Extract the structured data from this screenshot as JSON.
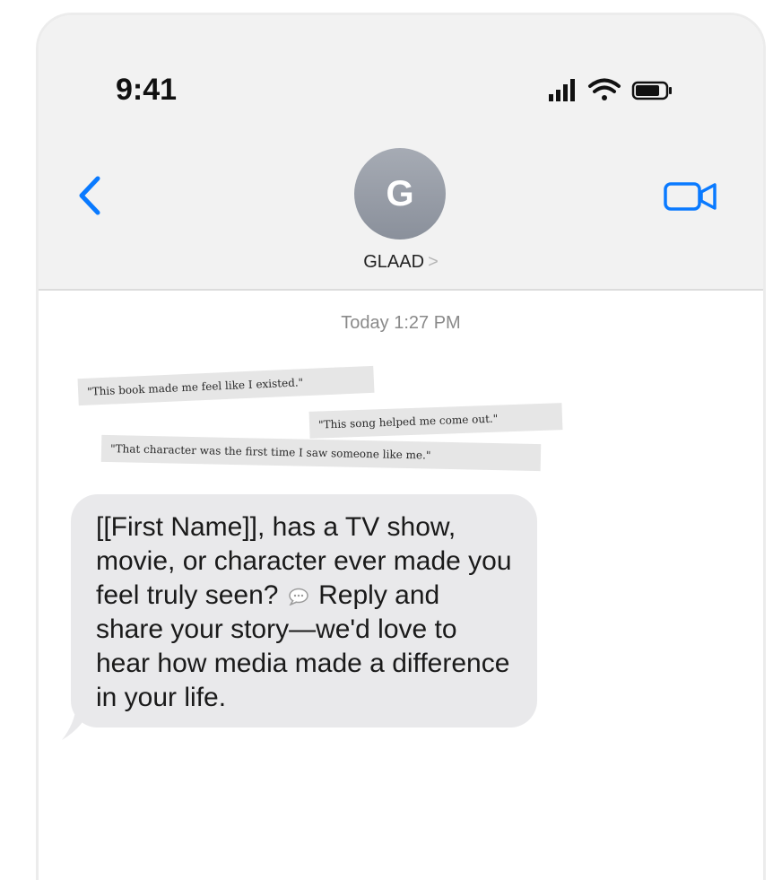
{
  "status_bar": {
    "time": "9:41"
  },
  "nav": {
    "contact_initial": "G",
    "contact_name": "GLAAD",
    "contact_chevron": ">"
  },
  "thread": {
    "timestamp": "Today 1:27 PM",
    "quotes": [
      "\"This book made me feel like I existed.\"",
      "\"This song helped me come out.\"",
      "\"That character was the first time I saw someone like me.\""
    ],
    "message": {
      "part1": "[[First Name]], has a TV show, movie, or character ever made you feel truly seen? ",
      "part2": " Reply and share your story—we'd love to hear how media made a difference in your life."
    }
  },
  "colors": {
    "accent": "#0a7aff",
    "bubble": "#e9e9eb",
    "header": "#f2f2f2"
  }
}
